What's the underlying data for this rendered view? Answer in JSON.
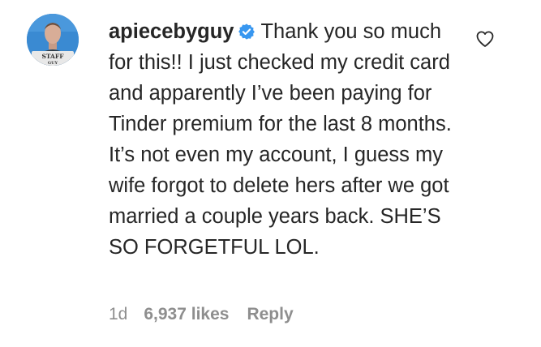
{
  "comment": {
    "username": "apiecebyguy",
    "verified": true,
    "verified_icon": "verified-badge-icon",
    "text": "Thank you so much for this!! I just checked my credit card and apparently I’ve been paying for Tinder premium for the last 8 months. It’s not even my account, I guess my wife forgot to delete hers after we got married a couple years back. SHE’S SO FORGETFUL LOL.",
    "time": "1d",
    "likes": "6,937 likes",
    "reply_label": "Reply",
    "like_icon": "heart-outline-icon"
  },
  "avatar": {
    "badge_line1": "STAFF",
    "badge_line2": "GUY"
  },
  "colors": {
    "text": "#262626",
    "meta": "#8e8e8e",
    "verified": "#3897f0",
    "background": "#ffffff"
  }
}
